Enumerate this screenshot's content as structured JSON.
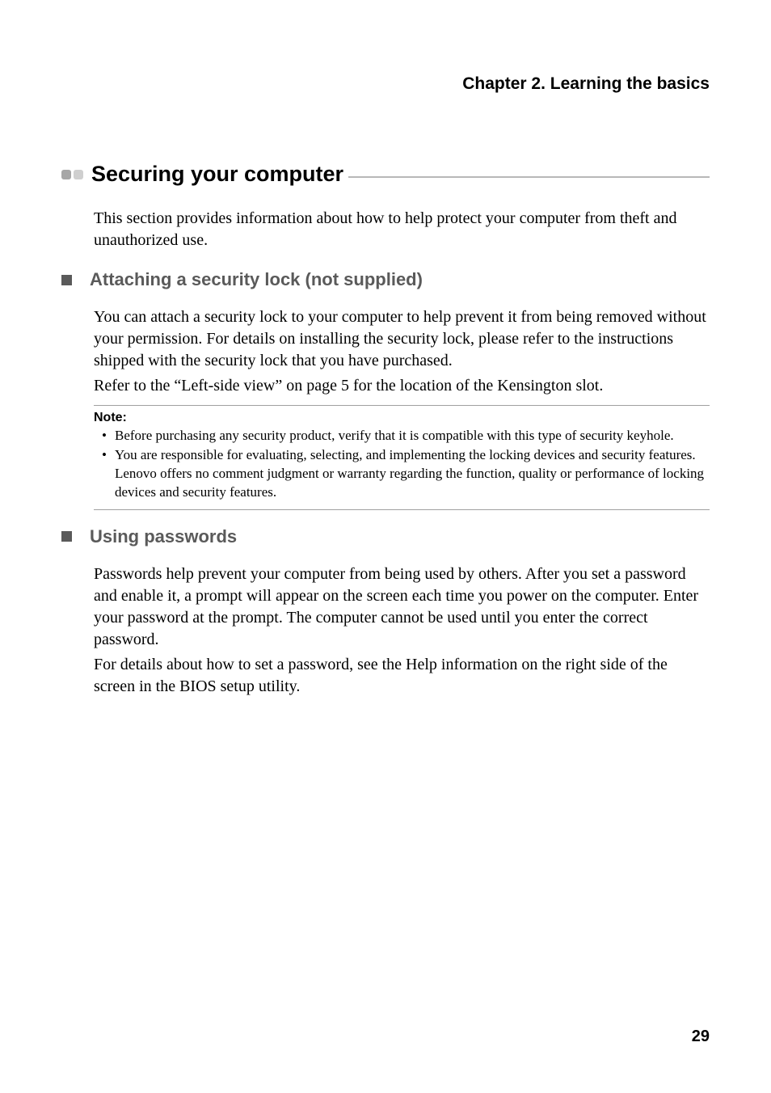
{
  "chapter_header": "Chapter 2. Learning the basics",
  "section": {
    "title": "Securing your computer",
    "intro": "This section provides information about how to help protect your computer from theft and unauthorized use."
  },
  "subsection1": {
    "title": "Attaching a security lock (not supplied)",
    "para1": "You can attach a security lock to your computer to help prevent it from being removed without your permission. For details on installing the security lock, please refer to the instructions shipped with the security lock that you have purchased.",
    "para2": "Refer to the “Left-side view” on page 5 for the location of the Kensington slot."
  },
  "note": {
    "label": "Note:",
    "items": [
      "Before purchasing any security product, verify that it is compatible with this type of security keyhole.",
      "You are responsible for evaluating, selecting, and implementing the locking devices and security features. Lenovo offers no comment judgment or warranty regarding the function, quality or performance of locking devices and security features."
    ]
  },
  "subsection2": {
    "title": "Using passwords",
    "para1": "Passwords help prevent your computer from being used by others. After you set a password and enable it, a prompt will appear on the screen each time you power on the computer. Enter your password at the prompt. The computer cannot be used until you enter the correct password.",
    "para2": "For details about how to set a password, see the Help information on the right side of the screen in the BIOS setup utility."
  },
  "page_number": "29"
}
